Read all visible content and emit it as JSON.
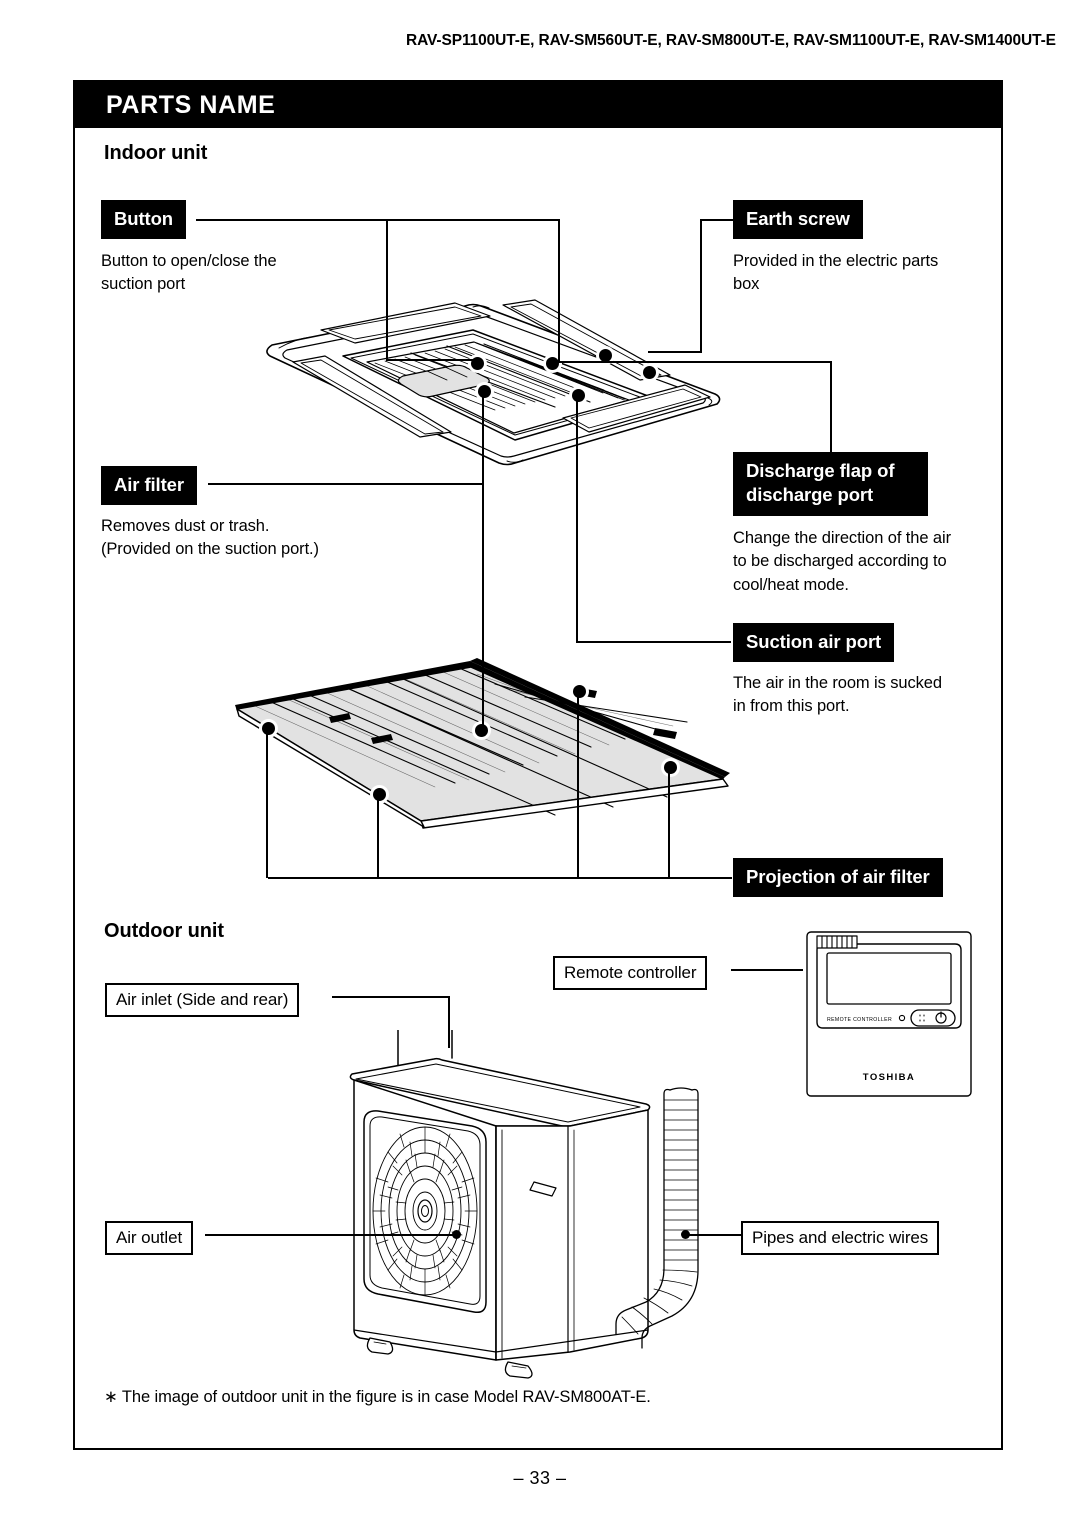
{
  "header": {
    "model_numbers": "RAV-SP1100UT-E,\nRAV-SM560UT-E, RAV-SM800UT-E, RAV-SM1100UT-E, RAV-SM1400UT-E"
  },
  "title_bar": {
    "title": "PARTS NAME"
  },
  "sections": {
    "indoor_heading": "Indoor unit",
    "outdoor_heading": "Outdoor unit"
  },
  "indoor_callouts": {
    "button": {
      "label": "Button",
      "description": "Button to open/close the\nsuction port"
    },
    "earth_screw": {
      "label": "Earth screw",
      "description": "Provided in the electric parts\nbox"
    },
    "air_filter": {
      "label": "Air filter",
      "description": "Removes dust or trash.\n(Provided on the suction port.)"
    },
    "discharge_flap": {
      "label": "Discharge flap of\ndischarge port",
      "description": "Change the direction of the air\nto be discharged according to\ncool/heat mode."
    },
    "suction_air_port": {
      "label": "Suction air port",
      "description": "The air in the room is sucked\nin from this port."
    },
    "projection_air_filter": {
      "label": "Projection of air filter"
    }
  },
  "outdoor_callouts": {
    "air_inlet": "Air inlet (Side and rear)",
    "air_outlet": "Air outlet",
    "remote_controller": "Remote controller",
    "pipes_and_wires": "Pipes and electric wires"
  },
  "remote_device": {
    "label_text": "REMOTE CONTROLLER",
    "brand": "TOSHIBA"
  },
  "footnote": "∗ The image of outdoor unit in the figure is in case Model RAV-SM800AT-E.",
  "page_number": "– 33 –",
  "colors": {
    "ink": "#000000",
    "paper": "#ffffff",
    "filter_fill": "#e2e2e2"
  }
}
